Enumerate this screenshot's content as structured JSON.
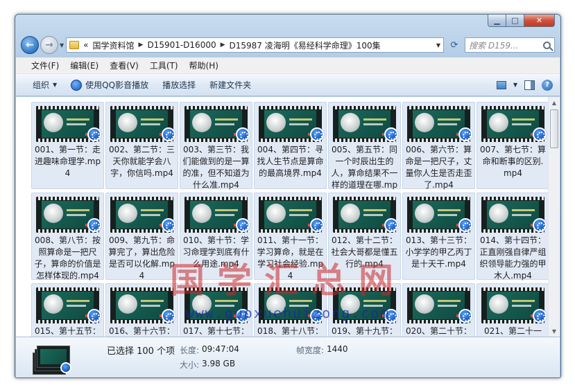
{
  "window": {
    "caption_buttons": {
      "minimize": "▁",
      "maximize": "□",
      "close": "✕"
    }
  },
  "address": {
    "back_icon": "arrow-left",
    "forward_icon": "arrow-right",
    "overflow": "«",
    "crumbs": [
      "国学资料馆",
      "D15901-D16000",
      "D15987 凌海明《易经科学命理》100集"
    ],
    "search_placeholder": "搜索 D159..."
  },
  "menu": [
    "文件(F)",
    "编辑(E)",
    "查看(V)",
    "工具(T)",
    "帮助(H)"
  ],
  "toolbar": {
    "organize": "组织",
    "play_with_qq": "使用QQ影音播放",
    "play_selected": "播放选择",
    "new_folder": "新建文件夹"
  },
  "files": [
    "001、第一节：走进趣味命理学.mp4",
    "002、第二节：三天你就能学会八字，你信吗.mp4",
    "003、第三节：我们能做到的是一算的准，但不知道为什么准.mp4",
    "004、第四节：寻找人生节点是算命的最高境界.mp4",
    "005、第五节：同一个时辰出生的人，算命结果不一样的道理在哪.mp4",
    "006、第六节：算命是一把尺子，丈量你人生是否走歪了.mp4",
    "007、第七节：算命和断事的区别.mp4",
    "008、第八节：按照算命是一把尺子，算命的价值是怎样体现的.mp4",
    "009、第九节：命算完了，算出危险是否可以化解.mp4",
    "010、第十节：学习命理学到底有什么用途.mp4",
    "011、第十一节：学习算命，就是在学习社会经验.mp4",
    "012、第十二节：社会大哥都是懂五行的.mp4",
    "013、第十三节：小学学的甲乙丙丁是十天干.mp4",
    "014、第十四节：正直刚强自律严组织领导能力强的甲木人.mp4",
    "015、第十五节：",
    "016、第十六节：",
    "017、第十七节：",
    "018、第十八节：",
    "019、第十九节：",
    "020、第二十节：",
    "021、第二十一"
  ],
  "watermark": {
    "main": "国学汇总网",
    "url": "www.guoxuehuizong.com"
  },
  "details": {
    "selected": "已选择 100 个项",
    "length_label": "长度:",
    "length_value": "09:47:04",
    "size_label": "大小:",
    "size_value": "3.98 GB",
    "width_label": "帧宽度:",
    "width_value": "1440"
  }
}
